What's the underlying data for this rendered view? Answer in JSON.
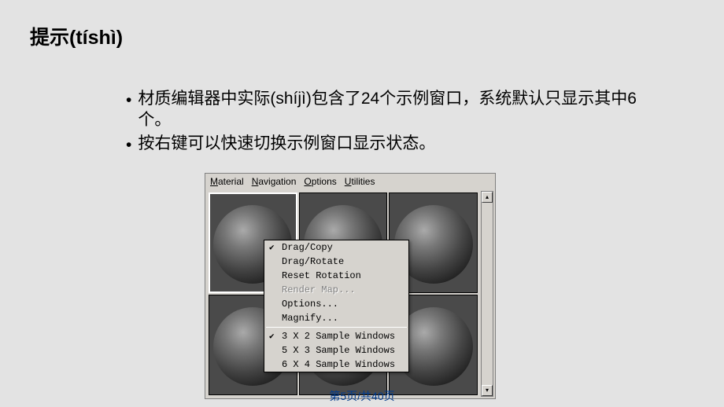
{
  "title": "提示(tíshì)",
  "bullets": [
    "材质编辑器中实际(shíjì)包含了24个示例窗口，系统默认只显示其中6个。",
    "按右键可以快速切换示例窗口显示状态。"
  ],
  "menubar": {
    "material": "Material",
    "navigation": "Navigation",
    "options": "Options",
    "utilities": "Utilities"
  },
  "context_menu": {
    "drag_copy": "Drag/Copy",
    "drag_rotate": "Drag/Rotate",
    "reset_rotation": "Reset Rotation",
    "render_map": "Render Map...",
    "options": "Options...",
    "magnify": "Magnify...",
    "s3x2": "3 X 2 Sample Windows",
    "s5x3": "5 X 3 Sample Windows",
    "s6x4": "6 X 4 Sample Windows"
  },
  "scroll": {
    "up": "▴",
    "down": "▾"
  },
  "footer": "第5页/共40页"
}
